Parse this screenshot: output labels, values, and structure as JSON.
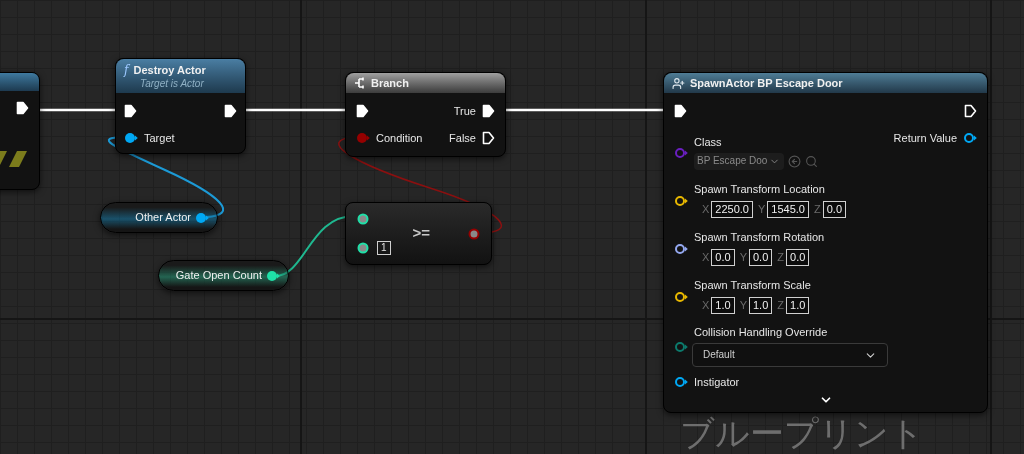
{
  "graph": {
    "watermark": "ブループリント"
  },
  "nodes": [
    {
      "kind": "partial",
      "outputs": [
        {
          "kind": "exec",
          "connected": true
        }
      ]
    },
    {
      "kind": "function",
      "icon": "f",
      "title": "Destroy Actor",
      "subtitle": "Target is Actor",
      "inputs": [
        {
          "kind": "exec",
          "connected": true
        },
        {
          "kind": "data",
          "label": "Target",
          "connected": true,
          "color": "#00a8f4"
        }
      ],
      "outputs": [
        {
          "kind": "exec",
          "connected": true
        }
      ]
    },
    {
      "kind": "branch",
      "title": "Branch",
      "inputs": [
        {
          "kind": "exec",
          "connected": true
        },
        {
          "kind": "data",
          "label": "Condition",
          "connected": true,
          "color": "#950000"
        }
      ],
      "outputs": [
        {
          "kind": "exec",
          "label": "True",
          "connected": true
        },
        {
          "kind": "exec",
          "label": "False",
          "connected": false
        }
      ]
    },
    {
      "kind": "variable",
      "title": "Other Actor",
      "outputs": [
        {
          "kind": "data",
          "connected": true,
          "color": "#00a8f4"
        }
      ]
    },
    {
      "kind": "variable",
      "title": "Gate Open Count",
      "outputs": [
        {
          "kind": "data",
          "connected": true,
          "color": "#1fe0a8"
        }
      ]
    },
    {
      "kind": "operator",
      "title": ">=",
      "inputs": [
        {
          "kind": "wildcard",
          "color": "#1fe0a8"
        },
        {
          "kind": "wildcard",
          "color": "#1fe0a8",
          "value": "1"
        }
      ],
      "outputs": [
        {
          "kind": "wildcard",
          "color": "#950000"
        }
      ]
    },
    {
      "kind": "spawn",
      "title": "SpawnActor BP Escape Door",
      "inputs": [
        {
          "kind": "exec",
          "connected": true
        },
        {
          "kind": "data",
          "label": "Class",
          "connected": false,
          "color": "#6a1fc0",
          "select": "BP Escape Doo"
        },
        {
          "kind": "data",
          "label": "Spawn Transform Location",
          "connected": false,
          "color": "#e8b800",
          "vector": [
            {
              "axis": "X",
              "value": "2250.0"
            },
            {
              "axis": "Y",
              "value": "1545.0"
            },
            {
              "axis": "Z",
              "value": "0.0"
            }
          ]
        },
        {
          "kind": "data",
          "label": "Spawn Transform Rotation",
          "connected": false,
          "color": "#94a8f0",
          "vector": [
            {
              "axis": "X",
              "value": "0.0"
            },
            {
              "axis": "Y",
              "value": "0.0"
            },
            {
              "axis": "Z",
              "value": "0.0"
            }
          ]
        },
        {
          "kind": "data",
          "label": "Spawn Transform Scale",
          "connected": false,
          "color": "#e8b800",
          "vector": [
            {
              "axis": "X",
              "value": "1.0"
            },
            {
              "axis": "Y",
              "value": "1.0"
            },
            {
              "axis": "Z",
              "value": "1.0"
            }
          ]
        },
        {
          "kind": "data",
          "label": "Collision Handling Override",
          "connected": false,
          "color": "#0c7a6c",
          "dropdown": "Default"
        },
        {
          "kind": "data",
          "label": "Instigator",
          "connected": false,
          "color": "#00a8f4"
        }
      ],
      "outputs": [
        {
          "kind": "exec",
          "connected": false
        },
        {
          "kind": "data",
          "label": "Return Value",
          "connected": false,
          "color": "#00a8f4"
        }
      ]
    }
  ]
}
